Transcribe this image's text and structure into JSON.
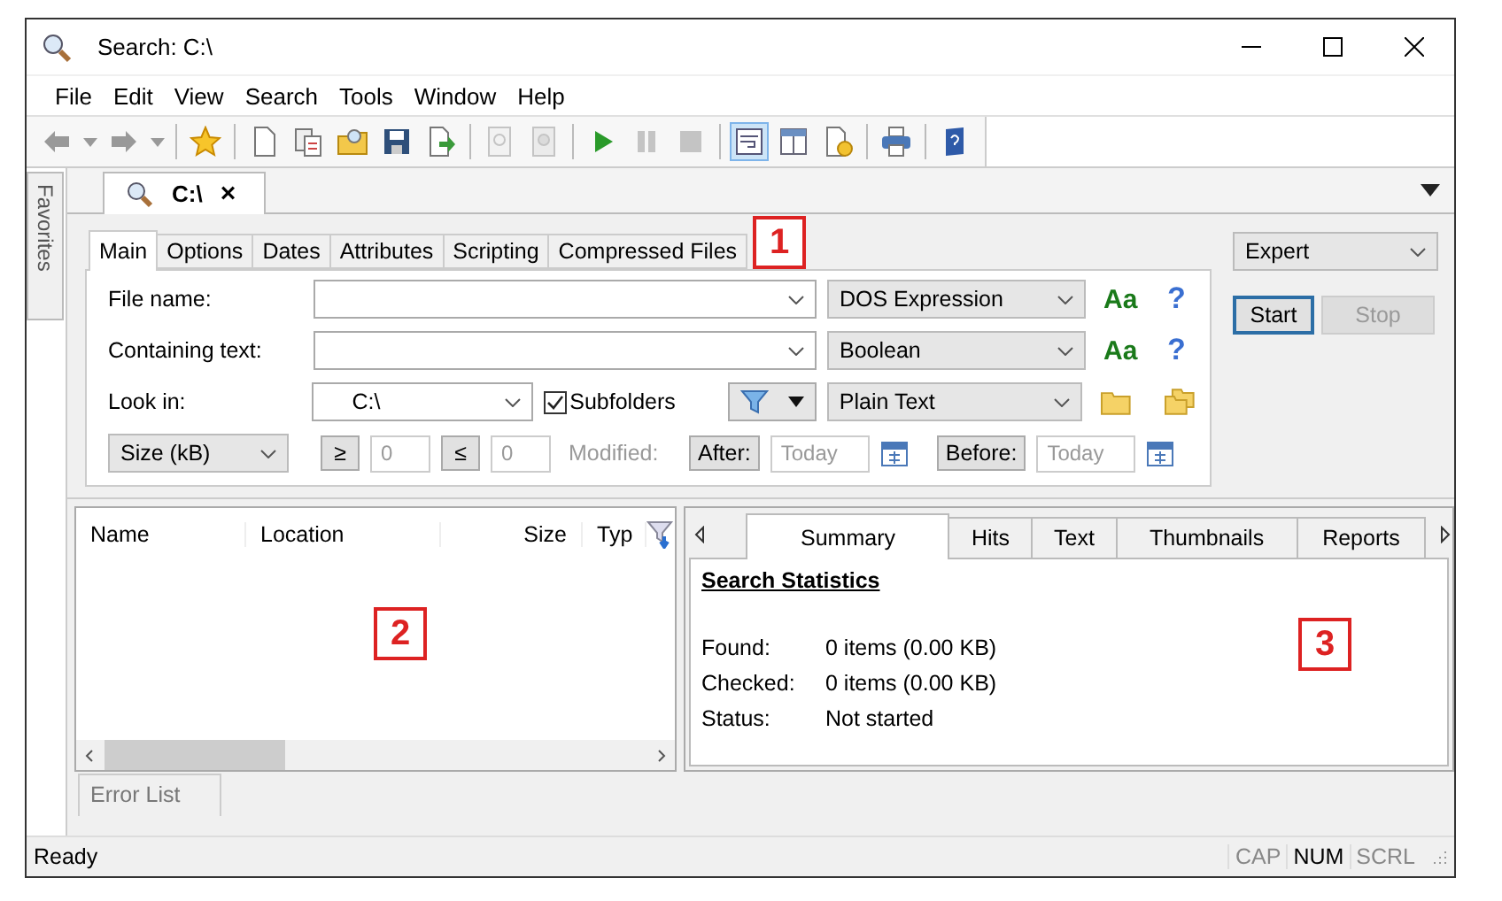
{
  "window": {
    "title": "Search: C:\\"
  },
  "menu": [
    "File",
    "Edit",
    "View",
    "Search",
    "Tools",
    "Window",
    "Help"
  ],
  "toolbar": [
    {
      "kind": "button",
      "disabled": false,
      "selected": false
    },
    {
      "kind": "dropdown",
      "disabled": false
    },
    {
      "kind": "button",
      "disabled": false,
      "selected": false
    },
    {
      "kind": "dropdown",
      "disabled": false
    },
    {
      "kind": "separator"
    },
    {
      "kind": "button",
      "disabled": false,
      "selected": false
    },
    {
      "kind": "separator"
    },
    {
      "kind": "button",
      "disabled": false,
      "selected": false
    },
    {
      "kind": "button",
      "disabled": false,
      "selected": false
    },
    {
      "kind": "button",
      "disabled": false,
      "selected": false
    },
    {
      "kind": "button",
      "disabled": false,
      "selected": false
    },
    {
      "kind": "button",
      "disabled": false,
      "selected": false
    },
    {
      "kind": "separator"
    },
    {
      "kind": "button",
      "disabled": true,
      "selected": false
    },
    {
      "kind": "button",
      "disabled": true,
      "selected": false
    },
    {
      "kind": "separator"
    },
    {
      "kind": "button",
      "disabled": false,
      "selected": false
    },
    {
      "kind": "button",
      "disabled": true,
      "selected": false
    },
    {
      "kind": "button",
      "disabled": true,
      "selected": false
    },
    {
      "kind": "separator"
    },
    {
      "kind": "button",
      "disabled": false,
      "selected": true
    },
    {
      "kind": "button",
      "disabled": false,
      "selected": false
    },
    {
      "kind": "button",
      "disabled": false,
      "selected": false
    },
    {
      "kind": "separator"
    },
    {
      "kind": "button",
      "disabled": false,
      "selected": false
    },
    {
      "kind": "separator"
    },
    {
      "kind": "button",
      "disabled": false,
      "selected": false
    }
  ],
  "side_tab": "Favorites",
  "document_tab": {
    "label": "C:\\",
    "close": "×"
  },
  "search_tabs": [
    {
      "label": "Main",
      "selected": true
    },
    {
      "label": "Options",
      "selected": false
    },
    {
      "label": "Dates",
      "selected": false
    },
    {
      "label": "Attributes",
      "selected": false
    },
    {
      "label": "Scripting",
      "selected": false
    },
    {
      "label": "Compressed Files",
      "selected": false
    }
  ],
  "fields": [
    {
      "label": "File name:",
      "mode": "DOS Expression",
      "case_toggle": "Aa",
      "help": "?"
    },
    {
      "label": "Containing text:",
      "mode": "Boolean",
      "case_toggle": "Aa",
      "help": "?"
    }
  ],
  "look_in": {
    "label": "Look in:",
    "value": "C:\\",
    "subfolders": {
      "label": "Subfolders",
      "checked": true
    },
    "mode": "Plain Text"
  },
  "size_filter": {
    "unit": "Size (kB)",
    "min_button": "≥",
    "min": "0",
    "max_button": "≤",
    "max": "0"
  },
  "date_filter": {
    "label": "Modified:",
    "disabled": true,
    "after_button": "After:",
    "after_placeholder": "Today",
    "before_button": "Before:",
    "before_placeholder": "Today"
  },
  "profile": "Expert",
  "buttons": [
    {
      "label": "Start",
      "disabled": false
    },
    {
      "label": "Stop",
      "disabled": true
    }
  ],
  "results": {
    "columns": [
      "Name",
      "Location",
      "Size",
      "Typ"
    ]
  },
  "summary_tabs": [
    {
      "label": "Summary",
      "selected": true
    },
    {
      "label": "Hits",
      "selected": false
    },
    {
      "label": "Text",
      "selected": false
    },
    {
      "label": "Thumbnails",
      "selected": false
    },
    {
      "label": "Reports",
      "selected": false
    }
  ],
  "summary": {
    "heading": "Search Statistics",
    "rows": [
      {
        "label": "Found:",
        "value": "0 items (0.00 KB)"
      },
      {
        "label": "Checked:",
        "value": "0 items (0.00 KB)"
      },
      {
        "label": "Status:",
        "value": "Not started"
      }
    ]
  },
  "callouts": [
    "1",
    "2",
    "3"
  ],
  "bottom_tab": "Error List",
  "status_bar": {
    "text": "Ready",
    "indicators": [
      {
        "label": "CAP",
        "on": false
      },
      {
        "label": "NUM",
        "on": true
      },
      {
        "label": "SCRL",
        "on": false
      }
    ]
  }
}
